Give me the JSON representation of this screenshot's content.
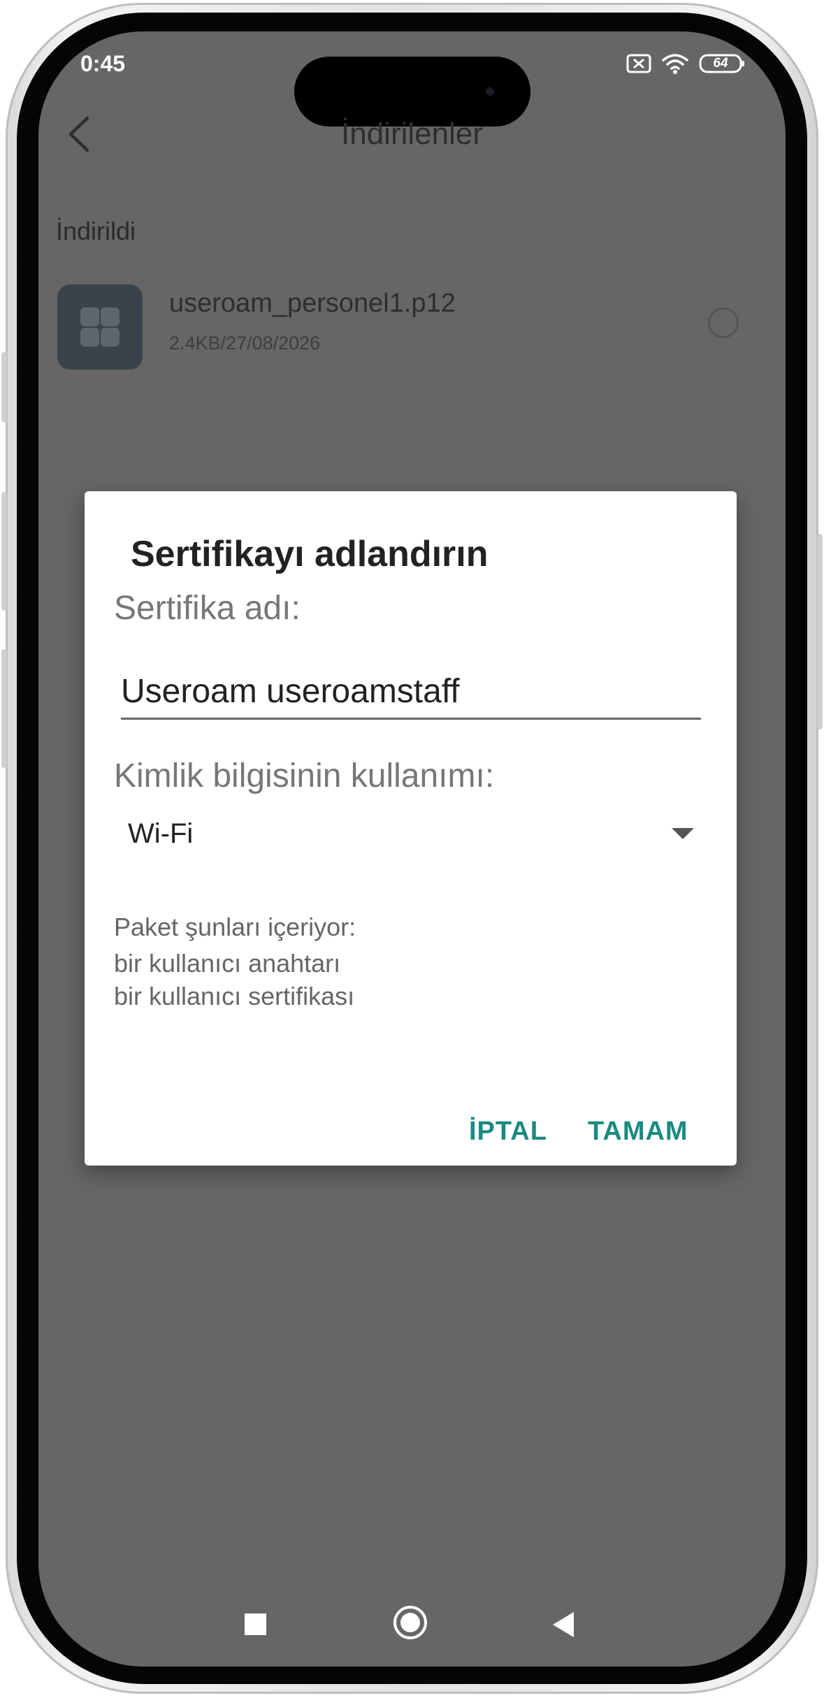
{
  "status_bar": {
    "time": "0:45",
    "battery_level": "64",
    "icons": [
      "sim-off-icon",
      "wifi-icon",
      "battery-icon"
    ]
  },
  "header": {
    "title": "İndirilenler",
    "back_icon": "back-chevron-icon"
  },
  "downloads": {
    "section_label": "İndirildi",
    "items": [
      {
        "icon": "app-grid-icon",
        "name": "useroam_personel1.p12",
        "meta": "2.4KB/27/08/2026"
      }
    ]
  },
  "dialog": {
    "title": "Sertifikayı adlandırın",
    "name_label": "Sertifika adı:",
    "name_value": "Useroam useroamstaff",
    "usage_label": "Kimlik bilgisinin kullanımı:",
    "usage_value": "Wi-Fi",
    "info_lines": [
      "Paket şunları içeriyor:",
      "bir kullanıcı anahtarı",
      "bir kullanıcı sertifikası"
    ],
    "cancel_label": "İPTAL",
    "ok_label": "TAMAM"
  },
  "nav_bar": {
    "icons": [
      "recents-square-icon",
      "home-circle-icon",
      "back-triangle-icon"
    ]
  },
  "colors": {
    "scrim": "#666666",
    "accent": "#1b8a7f",
    "dialog_bg": "#ffffff"
  }
}
